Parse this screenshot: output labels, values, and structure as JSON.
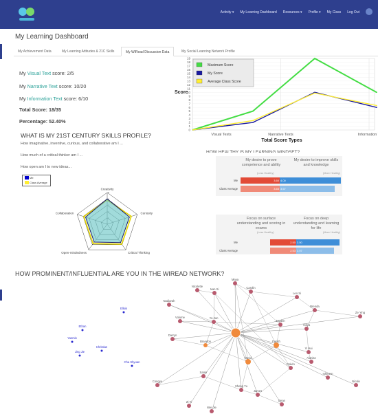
{
  "nav": {
    "items": [
      "Activity ▾",
      "My Learning Dashboard",
      "Resources ▾",
      "Profile ▾",
      "My Class",
      "Log Out"
    ]
  },
  "page_title": "My Learning Dashboard",
  "tabs": [
    "My Achievement Data",
    "My Learning Attitudes & 21C Skills",
    "My WiRead Discussion Data",
    "My Social Learning Network Profile"
  ],
  "scores": {
    "visual": {
      "pre": "My ",
      "hl": "Visual Text",
      "post": " score: 2/5"
    },
    "narrative": {
      "pre": "My ",
      "hl": "Narrative Text",
      "post": " score: 10/20"
    },
    "information": {
      "pre": "My ",
      "hl": "Information Text",
      "post": " score: 6/10"
    },
    "total": "Total Score: 18/35",
    "percentage": "Percentage: 52.40%"
  },
  "skills": {
    "heading": "WHAT IS MY 21ST CENTURY SKILLS PROFILE?",
    "questions": [
      "How imaginative, inventive, curious, and collaborative am I ...",
      "How much of a critical thinker am I ...",
      "How open am I to new ideas..."
    ],
    "legend": [
      "Me",
      "Class Average"
    ]
  },
  "radar_chart": {
    "type": "radar",
    "axes": [
      "Creativity",
      "Curiosity",
      "Critical Thinking",
      "Open-mindedness",
      "Collaboration"
    ],
    "ticks": [
      "1",
      "2",
      "3",
      "4",
      "5"
    ],
    "rmax": 5,
    "series": [
      {
        "name": "Me",
        "color": "#0000cc",
        "values": [
          4.0,
          3.7,
          3.6,
          3.5,
          3.6
        ]
      },
      {
        "name": "Class Average",
        "color": "#e6d800",
        "values": [
          3.8,
          4.0,
          3.9,
          3.8,
          3.9
        ]
      }
    ]
  },
  "chart_data": {
    "type": "line",
    "xlabel": "Total Score Types",
    "ylabel": "Score",
    "categories": [
      "Visual Texts",
      "Narrative Texts",
      "Information T"
    ],
    "yticks": [
      "0",
      "1",
      "2",
      "3",
      "4",
      "5",
      "6",
      "7",
      "8",
      "9",
      "10",
      "11",
      "12",
      "13",
      "14",
      "15",
      "16",
      "17",
      "18",
      "19"
    ],
    "ylim": [
      0,
      19
    ],
    "series": [
      {
        "name": "Maximum Score",
        "color": "#44dd44",
        "values": [
          5,
          20,
          10
        ]
      },
      {
        "name": "My Score",
        "color": "#1a1aa0",
        "values": [
          2,
          10,
          6
        ]
      },
      {
        "name": "Average Class Score",
        "color": "#ffee33",
        "values": [
          2.5,
          9.8,
          6.5
        ]
      }
    ]
  },
  "mindset": {
    "heading": "HOW HEALTHY IS MY LEARNING MINDSET?",
    "block1": {
      "left_head": "My desire to prove competence and ability",
      "right_head": "My desire to improve skills and knowledge",
      "left_small": "(Less Healthy)",
      "right_small": "(More Healthy)",
      "rows": [
        {
          "label": "Me",
          "left": "3.60",
          "right": "4.00"
        },
        {
          "label": "Class Average",
          "left": "3.65",
          "right": "3.67"
        }
      ]
    },
    "block2": {
      "left_head": "Focus on surface understanding and scoring in exams",
      "right_head": "Focus on deep understanding and learning for life",
      "left_small": "(Less Healthy)",
      "right_small": "(More Healthy)",
      "rows": [
        {
          "label": "Me",
          "left": "2.50",
          "right": "3.50"
        },
        {
          "label": "Class Average",
          "left": "2.53",
          "right": "3.07"
        }
      ]
    }
  },
  "network": {
    "title": "HOW PROMINENT/INFLUENTIAL ARE YOU IN THE WIREAD NETWORK?",
    "nodes": [
      {
        "name": "Maya"
      },
      {
        "name": "Nicolette"
      },
      {
        "name": "Ivan Si"
      },
      {
        "name": "Carolin"
      },
      {
        "name": "Leo Si"
      },
      {
        "name": "Nadiarah"
      },
      {
        "name": "Brenda"
      },
      {
        "name": "Ze Ying"
      },
      {
        "name": "Ellois"
      },
      {
        "name": "Volume"
      },
      {
        "name": "Yu Jun"
      },
      {
        "name": "Jayden"
      },
      {
        "name": "Vidya"
      },
      {
        "name": "Ethan"
      },
      {
        "name": "Darryn"
      },
      {
        "name": "Brandon"
      },
      {
        "name": "Yi Hui"
      },
      {
        "name": "Yasmin"
      },
      {
        "name": "Farish"
      },
      {
        "name": "Alanise"
      },
      {
        "name": "Christian"
      },
      {
        "name": "Calvin"
      },
      {
        "name": "Jing Jie"
      },
      {
        "name": "David"
      },
      {
        "name": "Cha Shyuan"
      },
      {
        "name": "Samir"
      },
      {
        "name": "Congyu"
      },
      {
        "name": "Ishmem"
      },
      {
        "name": "Sheng Yu"
      },
      {
        "name": "James"
      },
      {
        "name": "Dean"
      },
      {
        "name": "Nicole"
      },
      {
        "name": "Zi Yi"
      },
      {
        "name": "Wei Jie"
      }
    ]
  }
}
